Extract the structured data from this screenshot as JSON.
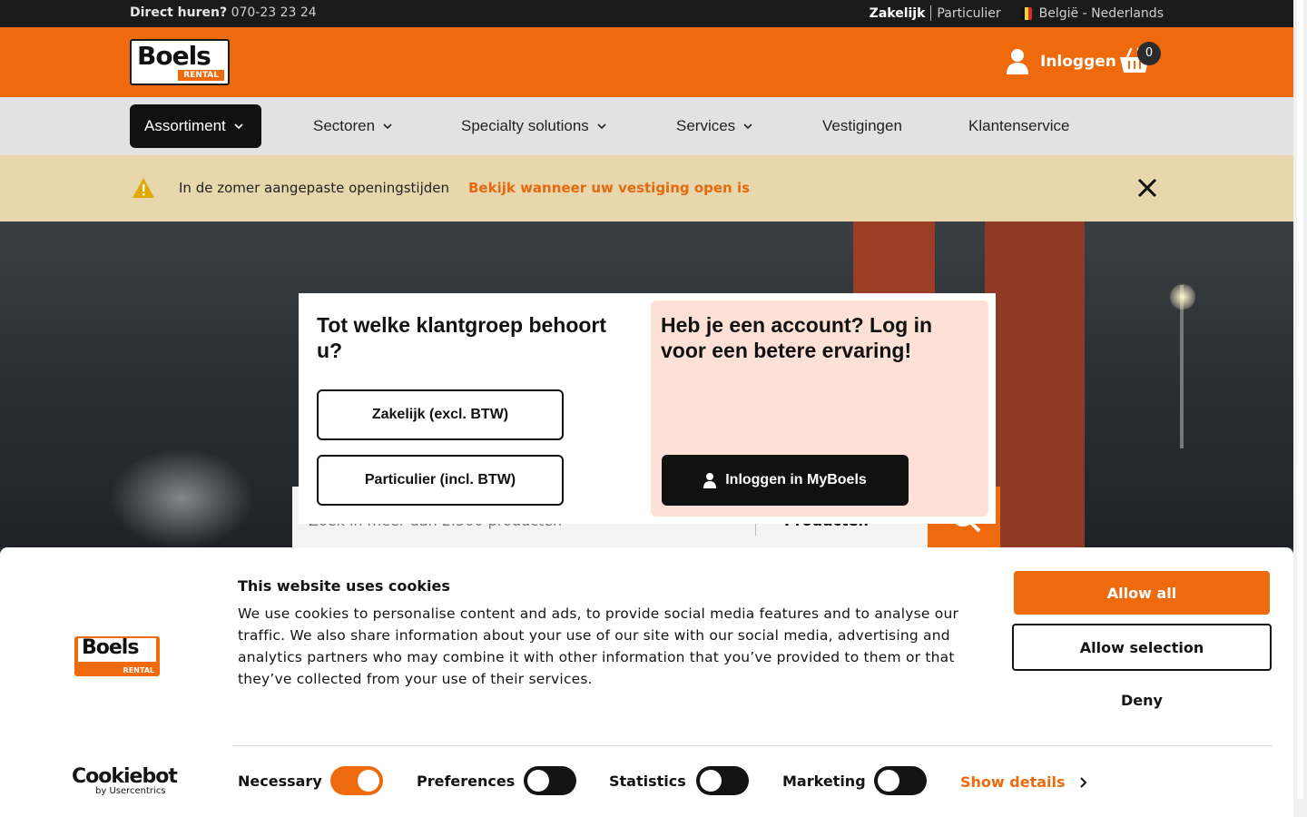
{
  "topbar": {
    "phone_label": "Direct huren?",
    "phone_number": "070-23 23 24",
    "segment_business": "Zakelijk",
    "segment_private": "Particulier",
    "locale": "België - Nederlands"
  },
  "header": {
    "logo_word": "Boels",
    "logo_sub": "RENTAL",
    "login_label": "Inloggen",
    "cart_count": "0"
  },
  "nav": {
    "items": [
      {
        "label": "Assortiment"
      },
      {
        "label": "Sectoren"
      },
      {
        "label": "Specialty solutions"
      },
      {
        "label": "Services"
      },
      {
        "label": "Vestigingen"
      },
      {
        "label": "Klantenservice"
      }
    ]
  },
  "notice": {
    "text": "In de zomer aangepaste openingstijden",
    "link": "Bekijk wanneer uw vestiging open is"
  },
  "hero": {
    "search_placeholder": "Zoek in meer dan 2.500 producten",
    "search_scope": "Producten"
  },
  "modal": {
    "left_title": "Tot welke klantgroep behoort u?",
    "option_business": "Zakelijk (excl. BTW)",
    "option_private": "Particulier (incl. BTW)",
    "right_title": "Heb je een account? Log in voor een betere ervaring!",
    "login_button": "Inloggen in MyBoels"
  },
  "cookie": {
    "title": "This website uses cookies",
    "body": "We use cookies to personalise content and ads, to provide social media features and to analyse our traffic. We also share information about your use of our site with our social media, advertising and analytics partners who may combine it with other information that you’ve provided to them or that they’ve collected from your use of their services.",
    "allow_all": "Allow all",
    "allow_selection": "Allow selection",
    "deny": "Deny",
    "toggles": [
      {
        "label": "Necessary",
        "on": true
      },
      {
        "label": "Preferences",
        "on": false
      },
      {
        "label": "Statistics",
        "on": false
      },
      {
        "label": "Marketing",
        "on": false
      }
    ],
    "show_details": "Show details",
    "provider_big": "Cookiebot",
    "provider_small": "by Usercentrics"
  },
  "colors": {
    "brand_orange": "#ee6a0c",
    "notice_bg": "#e8d7ac",
    "login_pane_bg": "#fde1d7"
  }
}
